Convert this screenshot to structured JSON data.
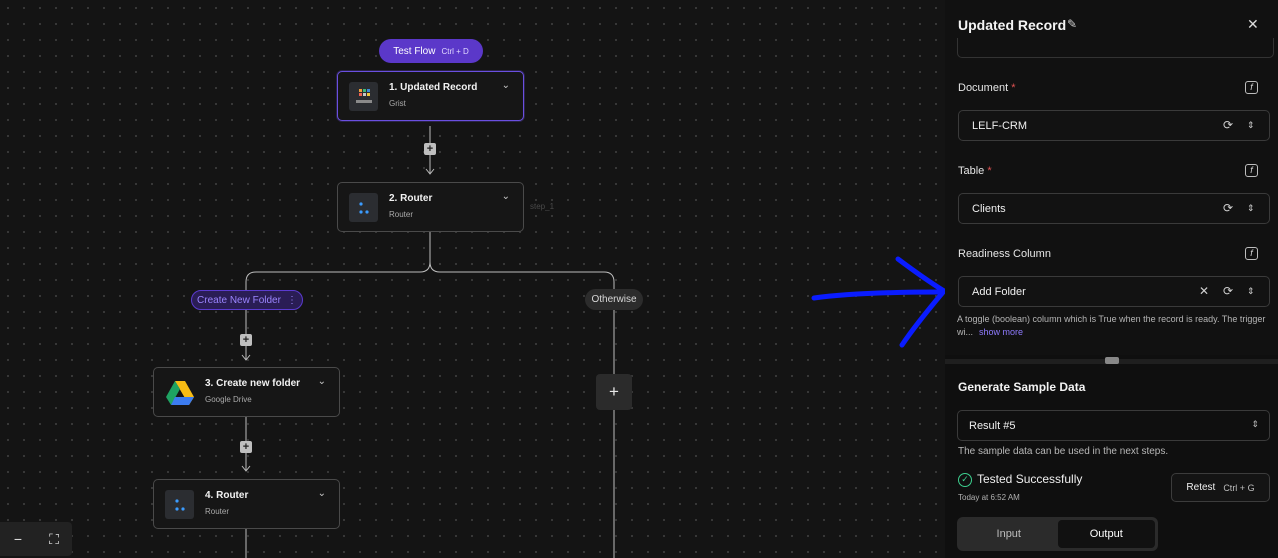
{
  "canvas": {
    "test_flow": {
      "label": "Test Flow",
      "shortcut": "Ctrl + D"
    },
    "nodes": [
      {
        "title": "1. Updated Record",
        "subtitle": "Grist",
        "logo": "grist-logo"
      },
      {
        "title": "2. Router",
        "subtitle": "Router",
        "logo": "router-icon"
      },
      {
        "title": "3. Create new folder",
        "subtitle": "Google Drive",
        "logo": "google-drive-logo"
      },
      {
        "title": "4. Router",
        "subtitle": "Router",
        "logo": "router-icon"
      }
    ],
    "step_label": "step_1",
    "branches": {
      "create": "Create New Folder",
      "otherwise": "Otherwise"
    }
  },
  "panel": {
    "title": "Updated Record",
    "document": {
      "label": "Document",
      "value": "LELF-CRM"
    },
    "table": {
      "label": "Table",
      "value": "Clients"
    },
    "readiness": {
      "label": "Readiness Column",
      "value": "Add Folder",
      "help": "A toggle (boolean) column which is True when the record is ready. The trigger wi...",
      "show_more": "show more"
    },
    "sample": {
      "title": "Generate Sample Data",
      "result": "Result #5",
      "note": "The sample data can be used in the next steps.",
      "status": "Tested Successfully",
      "time": "Today at 6:52 AM",
      "retest_label": "Retest",
      "retest_shortcut": "Ctrl + G",
      "tabs": [
        "Input",
        "Output"
      ],
      "active_tab": "Output"
    }
  },
  "colors": {
    "accent": "#5b38c9",
    "annotation": "#0a1cff",
    "success": "#3ccf8e"
  }
}
